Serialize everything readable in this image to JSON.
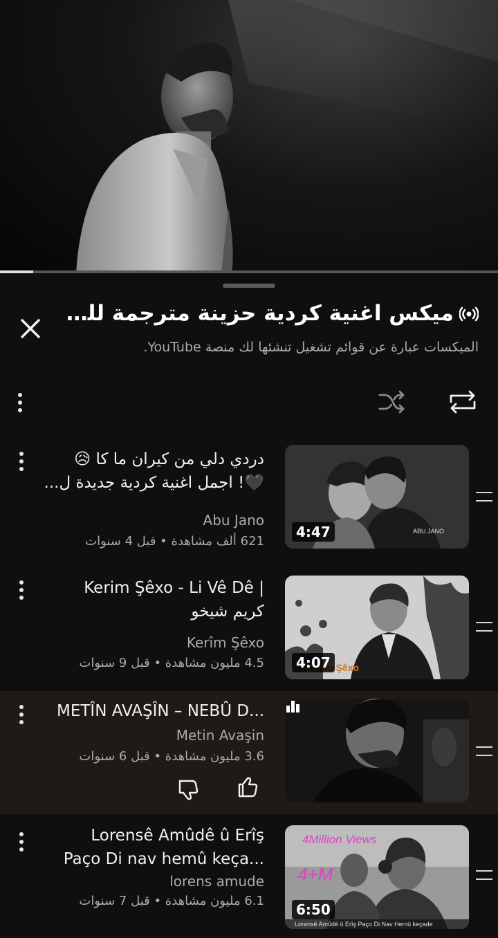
{
  "player": {
    "progress_fraction": 0.067
  },
  "playlist": {
    "title": "ميكس اغنية كردية حزينة مترجمة للع...",
    "title_icon": "mix-radio-icon",
    "subtitle": "الميكسات عبارة عن قوائم تشغيل تنشئها لك منصة YouTube.",
    "controls": {
      "close_icon": "close-icon",
      "menu_icon": "more-vert-icon",
      "shuffle_icon": "shuffle-icon",
      "repeat_icon": "repeat-icon"
    }
  },
  "videos": [
    {
      "title_line1": "دردي دلي من كيران ما كا 😥",
      "title_line2": "🖤! اجمل اغنية كردية جديدة ل...",
      "channel": "Abu Jano",
      "meta": "621 ألف مشاهدة • قبل 4 سنوات",
      "duration": "4:47",
      "thumb_caption": "ABU JANO",
      "active": false
    },
    {
      "title_line1": "Kerim Şêxo - Li Vê Dê |",
      "title_line2": "كريم شيخو",
      "channel": "Kerîm Şêxo",
      "meta": "4.5 مليون مشاهدة • قبل 9 سنوات",
      "duration": "4:07",
      "thumb_caption": "Kerîm Şêxo",
      "active": false
    },
    {
      "title_line1": "METÎN AVAŞÎN – NEBÛ D...",
      "channel": "Metin Avaşin",
      "meta": "3.6 مليون مشاهدة • قبل 6 سنوات",
      "active": true,
      "status": "now-playing"
    },
    {
      "title_line1": "Lorensê Amûdê û Erîş",
      "title_line2": "Paço Di nav hemû keça...",
      "channel": "lorens amude",
      "meta": "6.1 مليون مشاهدة • قبل 7 سنوات",
      "duration": "6:50",
      "thumb_banner": "4Million Views",
      "thumb_badge": "4+M",
      "thumb_caption": "Lorensê Amûdê û Erîş Paço Di Nav Hemû keçade",
      "active": false
    }
  ],
  "colors": {
    "background": "#0f0f0f",
    "active_row": "#1f1a16",
    "text_primary": "#f1f1f1",
    "text_secondary": "#aaaaaa",
    "banner_magenta": "#e040c8"
  }
}
